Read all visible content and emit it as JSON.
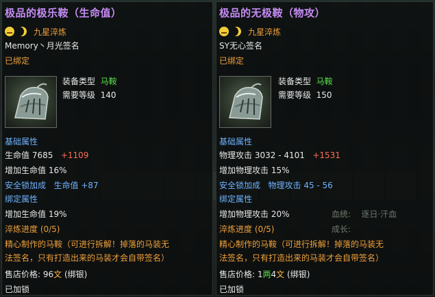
{
  "left": {
    "title": "极品的极乐鞍（生命值）",
    "refine": "九星淬炼",
    "signature": "Memory丶月光签名",
    "bound": "已绑定",
    "equip_type_label": "装备类型",
    "equip_type_value": "马鞍",
    "req_level_label": "需要等级",
    "req_level_value": "140",
    "base_attr_header": "基础属性",
    "stat1_label": "生命值",
    "stat1_value": "7685",
    "stat1_bonus": "+1109",
    "stat2": "增加生命值 16%",
    "safety_lock": "安全锁加成",
    "safety_stat": "生命值",
    "safety_value": "+87",
    "bind_attr_header": "绑定属性",
    "bind_stat": "增加生命值 19%",
    "refine_progress": "淬炼进度 (0/5)",
    "desc_line1": "精心制作的马鞍（可进行拆解！掉落的马装无",
    "desc_line2": "法签名，只有打造出来的马装才会自带签名）",
    "price_label": "售店价格:",
    "price_value": "96",
    "price_unit": "文",
    "price_note": "(绑银)",
    "locked": "已加锁"
  },
  "right": {
    "title": "极品的无极鞍（物攻）",
    "refine": "九星淬炼",
    "signature": "SY无心签名",
    "bound": "已绑定",
    "equip_type_label": "装备类型",
    "equip_type_value": "马鞍",
    "req_level_label": "需要等级",
    "req_level_value": "150",
    "base_attr_header": "基础属性",
    "stat1_label": "物理攻击",
    "stat1_value": "3032 - 4101",
    "stat1_bonus": "+1531",
    "stat2": "增加物理攻击 15%",
    "safety_lock": "安全锁加成",
    "safety_stat": "物理攻击",
    "safety_value": "45 - 56",
    "bind_attr_header": "绑定属性",
    "bind_stat": "增加物理攻击 20%",
    "refine_progress": "淬炼进度 (0/5)",
    "desc_line1": "精心制作的马鞍（可进行拆解！掉落的马装无",
    "desc_line2": "法签名，只有打造出来的马装才会自带签名）",
    "price_label": "售店价格:",
    "price_v1": "1",
    "price_u1": "两",
    "price_v2": "4",
    "price_u2": "文",
    "price_note": "(绑银)",
    "locked": "已加锁"
  },
  "background": {
    "label1": "血统:",
    "value1": "逐日·汗血",
    "label2": "成长:"
  },
  "colors": {
    "title": "#c58cf5",
    "orange": "#f0a03a",
    "blue": "#6fb3ff",
    "green": "#58e14a",
    "red": "#ff6d56"
  }
}
